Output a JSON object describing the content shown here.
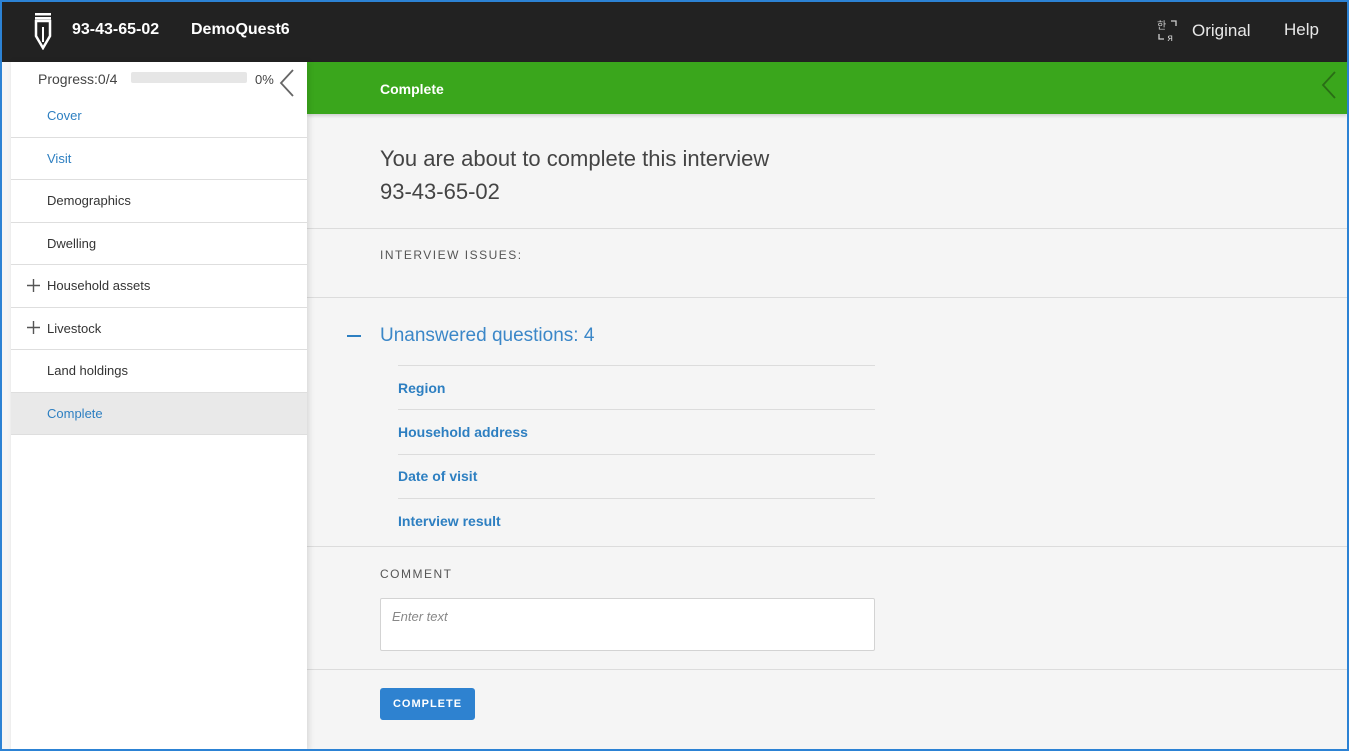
{
  "header": {
    "interview_key": "93-43-65-02",
    "questionnaire": "DemoQuest6",
    "language_label": "Original",
    "help_label": "Help"
  },
  "sidebar": {
    "progress_label": "Progress:0/4",
    "progress_percent": "0%",
    "progress_value": 0,
    "items": [
      {
        "label": "Cover",
        "style": "link"
      },
      {
        "label": "Visit",
        "style": "link"
      },
      {
        "label": "Demographics",
        "style": "normal"
      },
      {
        "label": "Dwelling",
        "style": "normal"
      },
      {
        "label": "Household assets",
        "style": "normal",
        "expandable": true
      },
      {
        "label": "Livestock",
        "style": "normal",
        "expandable": true
      },
      {
        "label": "Land holdings",
        "style": "normal"
      },
      {
        "label": "Complete",
        "style": "active"
      }
    ]
  },
  "main": {
    "section_title": "Complete",
    "headline_line1": "You are about to complete this interview",
    "headline_line2": "93-43-65-02",
    "issues_caption": "INTERVIEW ISSUES:",
    "unanswered_title": "Unanswered questions: 4",
    "unanswered_items": [
      "Region",
      "Household address",
      "Date of visit",
      "Interview result"
    ],
    "comment_caption": "COMMENT",
    "comment_placeholder": "Enter text",
    "complete_button": "COMPLETE"
  },
  "colors": {
    "topbar": "#222222",
    "section_header": "#3aa61c",
    "accent": "#2d7fc1",
    "button": "#2e82d0"
  }
}
